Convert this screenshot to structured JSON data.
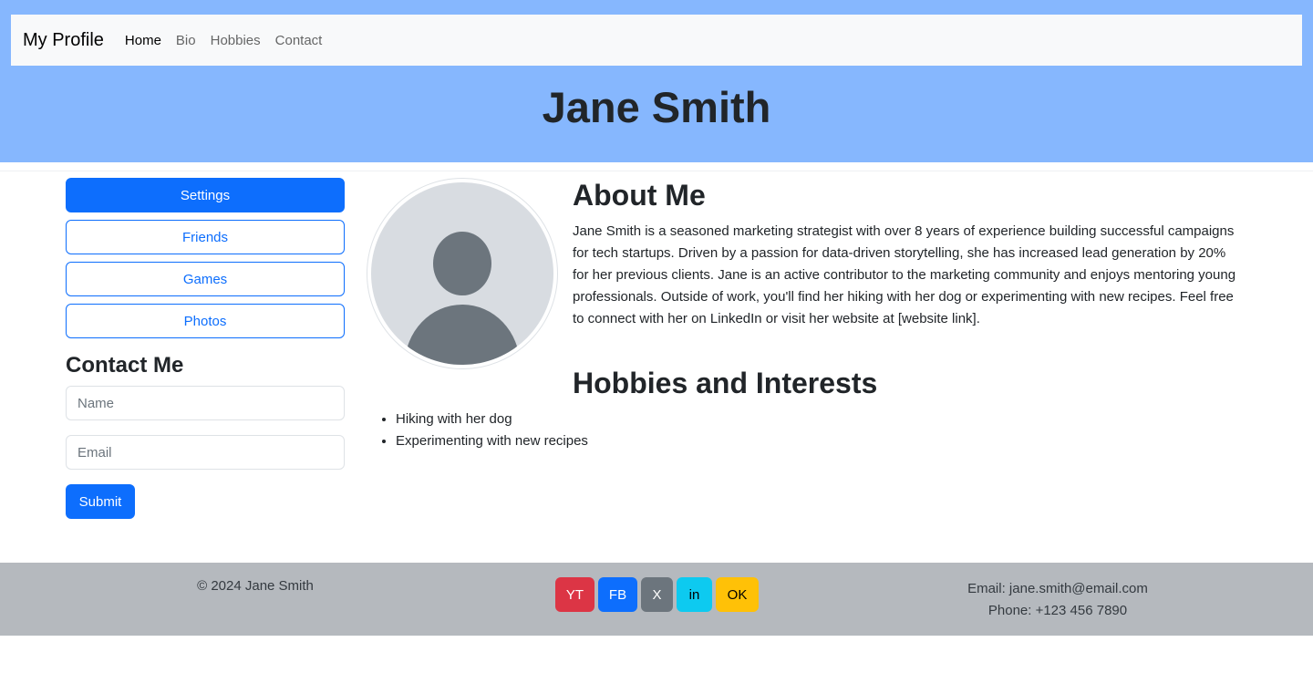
{
  "navbar": {
    "brand": "My Profile",
    "links": [
      "Home",
      "Bio",
      "Hobbies",
      "Contact"
    ]
  },
  "header": {
    "title": "Jane Smith"
  },
  "sidebar": {
    "buttons": [
      "Settings",
      "Friends",
      "Games",
      "Photos"
    ],
    "contact": {
      "title": "Contact Me",
      "name_placeholder": "Name",
      "email_placeholder": "Email",
      "submit_label": "Submit"
    }
  },
  "about": {
    "title": "About Me",
    "text": "Jane Smith is a seasoned marketing strategist with over 8 years of experience building successful campaigns for tech startups. Driven by a passion for data-driven storytelling, she has increased lead generation by 20% for her previous clients. Jane is an active contributor to the marketing community and enjoys mentoring young professionals. Outside of work, you'll find her hiking with her dog or experimenting with new recipes. Feel free to connect with her on LinkedIn or visit her website at [website link]."
  },
  "hobbies": {
    "title": "Hobbies and Interests",
    "items": [
      "Hiking with her dog",
      "Experimenting with new recipes"
    ]
  },
  "footer": {
    "copyright": "© 2024 Jane Smith",
    "social": [
      {
        "label": "YT",
        "color": "#dc3545",
        "text_color": "#ffffff"
      },
      {
        "label": "FB",
        "color": "#0d6efd",
        "text_color": "#ffffff"
      },
      {
        "label": "X",
        "color": "#6c757d",
        "text_color": "#ffffff"
      },
      {
        "label": "in",
        "color": "#0dcaf0",
        "text_color": "#000000"
      },
      {
        "label": "OK",
        "color": "#ffc107",
        "text_color": "#000000"
      }
    ],
    "email": "Email: jane.smith@email.com",
    "phone": "Phone: +123 456 7890"
  },
  "colors": {
    "header_bg": "#86b7fe",
    "primary": "#0d6efd",
    "footer_bg": "#b5b9be"
  },
  "icons": {
    "avatar": "user-avatar-icon"
  }
}
